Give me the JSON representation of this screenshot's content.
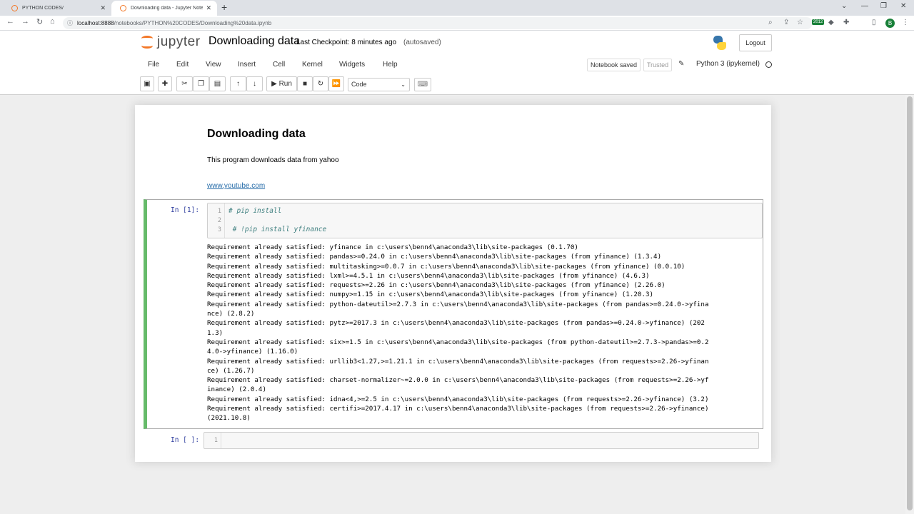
{
  "browser": {
    "tabs": [
      {
        "title": "PYTHON CODES/",
        "active": false
      },
      {
        "title": "Downloading data - Jupyter Note",
        "active": true
      }
    ],
    "new_tab": "+",
    "url_host": "localhost:8888",
    "url_path": "/notebooks/PYTHON%20CODES/Downloading%20data.ipynb",
    "ext_badge": "2012",
    "profile_initial": "B",
    "window_controls": [
      "⌄",
      "—",
      "❐",
      "✕"
    ]
  },
  "jupyter": {
    "logo_text": "jupyter",
    "notebook_title": "Downloading data",
    "checkpoint": "Last Checkpoint: 8 minutes ago",
    "autosave": "(autosaved)",
    "logout": "Logout",
    "menu": [
      "File",
      "Edit",
      "View",
      "Insert",
      "Cell",
      "Kernel",
      "Widgets",
      "Help"
    ],
    "notebook_saved": "Notebook saved",
    "trusted": "Trusted",
    "kernel": "Python 3 (ipykernel)",
    "run_label": "Run",
    "cell_type": "Code"
  },
  "notebook": {
    "heading": "Downloading data",
    "paragraph": "This program downloads data from yahoo",
    "link": "www.youtube.com",
    "cell1": {
      "prompt": "In [1]:",
      "lines": [
        {
          "num": "1",
          "code": "# pip install"
        },
        {
          "num": "2",
          "code": ""
        },
        {
          "num": "3",
          "code": " # !pip install yfinance"
        }
      ],
      "output": [
        "Requirement already satisfied: yfinance in c:\\users\\benn4\\anaconda3\\lib\\site-packages (0.1.70)",
        "Requirement already satisfied: pandas>=0.24.0 in c:\\users\\benn4\\anaconda3\\lib\\site-packages (from yfinance) (1.3.4)",
        "Requirement already satisfied: multitasking>=0.0.7 in c:\\users\\benn4\\anaconda3\\lib\\site-packages (from yfinance) (0.0.10)",
        "Requirement already satisfied: lxml>=4.5.1 in c:\\users\\benn4\\anaconda3\\lib\\site-packages (from yfinance) (4.6.3)",
        "Requirement already satisfied: requests>=2.26 in c:\\users\\benn4\\anaconda3\\lib\\site-packages (from yfinance) (2.26.0)",
        "Requirement already satisfied: numpy>=1.15 in c:\\users\\benn4\\anaconda3\\lib\\site-packages (from yfinance) (1.20.3)",
        "Requirement already satisfied: python-dateutil>=2.7.3 in c:\\users\\benn4\\anaconda3\\lib\\site-packages (from pandas>=0.24.0->yfina",
        "nce) (2.8.2)",
        "Requirement already satisfied: pytz>=2017.3 in c:\\users\\benn4\\anaconda3\\lib\\site-packages (from pandas>=0.24.0->yfinance) (202",
        "1.3)",
        "Requirement already satisfied: six>=1.5 in c:\\users\\benn4\\anaconda3\\lib\\site-packages (from python-dateutil>=2.7.3->pandas>=0.2",
        "4.0->yfinance) (1.16.0)",
        "Requirement already satisfied: urllib3<1.27,>=1.21.1 in c:\\users\\benn4\\anaconda3\\lib\\site-packages (from requests>=2.26->yfinan",
        "ce) (1.26.7)",
        "Requirement already satisfied: charset-normalizer~=2.0.0 in c:\\users\\benn4\\anaconda3\\lib\\site-packages (from requests>=2.26->yf",
        "inance) (2.0.4)",
        "Requirement already satisfied: idna<4,>=2.5 in c:\\users\\benn4\\anaconda3\\lib\\site-packages (from requests>=2.26->yfinance) (3.2)",
        "Requirement already satisfied: certifi>=2017.4.17 in c:\\users\\benn4\\anaconda3\\lib\\site-packages (from requests>=2.26->yfinance)",
        "(2021.10.8)"
      ]
    },
    "cell2": {
      "prompt": "In [ ]:",
      "line_num": "1"
    }
  },
  "colors": {
    "jupyter_orange": "#f37726",
    "selected_cell_border": "#66bb6a",
    "prompt_blue": "#303f9f",
    "link_blue": "#296eaa"
  }
}
